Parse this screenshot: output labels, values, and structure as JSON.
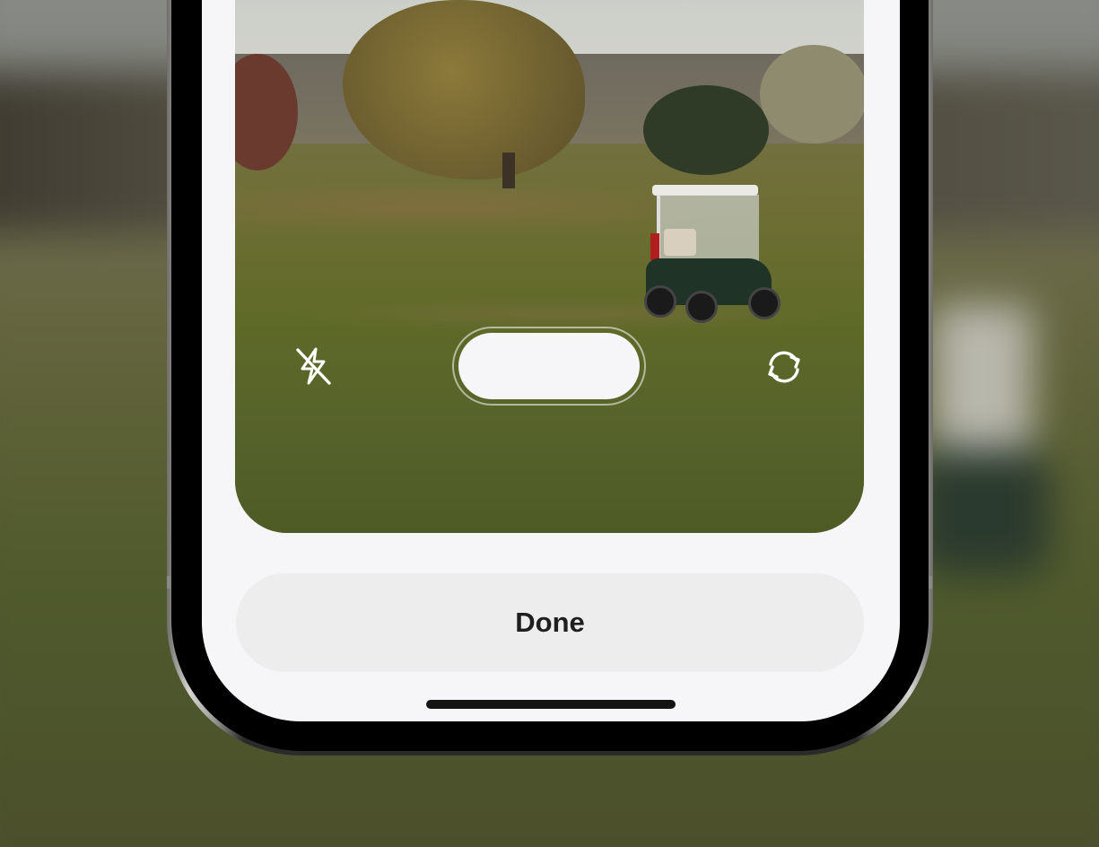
{
  "screen": {
    "done_button": {
      "label": "Done"
    }
  },
  "camera": {
    "flash": {
      "icon": "flash-off-icon",
      "state": "off"
    },
    "switch_camera": {
      "icon": "camera-rotate-icon"
    },
    "shutter": {
      "icon": "shutter-button"
    }
  },
  "colors": {
    "screen_background": "#f6f6f8",
    "done_button_background": "#ededee",
    "done_text": "#1f1f1f",
    "icon_color": "#ffffff"
  }
}
